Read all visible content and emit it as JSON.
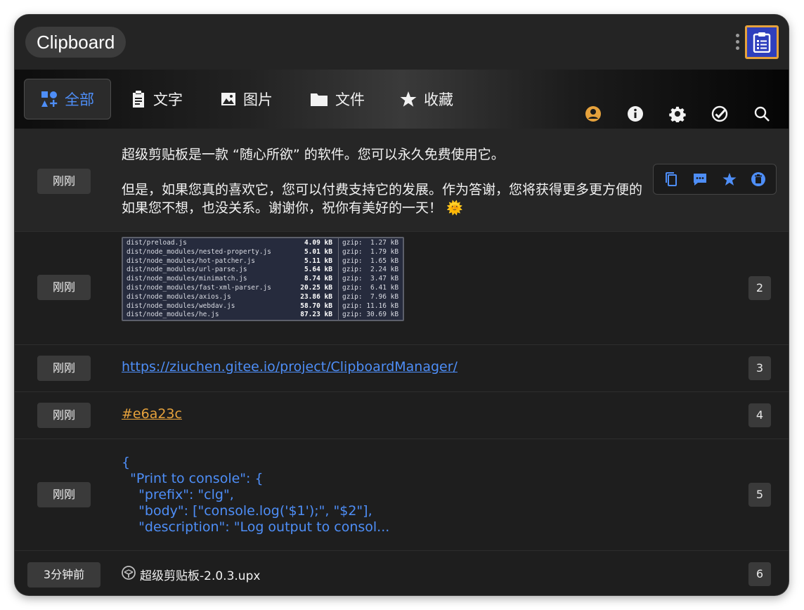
{
  "app": {
    "title": "Clipboard",
    "icon": "clipboard-list-icon"
  },
  "tabs": [
    {
      "label": "全部",
      "icon": "apps-icon",
      "active": true
    },
    {
      "label": "文字",
      "icon": "clipboard-text-icon"
    },
    {
      "label": "图片",
      "icon": "image-icon"
    },
    {
      "label": "文件",
      "icon": "folder-icon"
    },
    {
      "label": "收藏",
      "icon": "star-icon"
    }
  ],
  "tools": [
    "user-circle-icon",
    "info-icon",
    "gear-icon",
    "check-circle-icon",
    "search-icon"
  ],
  "colors": {
    "accent": "#4e8ef7",
    "orange": "#e6a23c",
    "bg": "#1e1e1e",
    "badge": "#3a3a3a"
  },
  "items": [
    {
      "time": "刚刚",
      "type": "text",
      "lines": [
        "超级剪贴板是一款 “随心所欲” 的软件。您可以永久免费使用它。",
        "但是，如果您真的喜欢它，您可以付费支持它的发展。作为答谢，您将获得更多更方便的",
        "如果您不想，也没关系。谢谢你，祝你有美好的一天！ 🌞"
      ],
      "actions": [
        "copy-icon",
        "comment-icon",
        "star-icon",
        "delete-icon"
      ]
    },
    {
      "time": "刚刚",
      "type": "image",
      "index": "2",
      "image_lines": [
        {
          "file": "dist/preload.js",
          "size": "4.09 kB",
          "gzip": "gzip:  1.27 kB"
        },
        {
          "file": "dist/node_modules/nested-property.js",
          "size": "5.01 kB",
          "gzip": "gzip:  1.79 kB"
        },
        {
          "file": "dist/node_modules/hot-patcher.js",
          "size": "5.11 kB",
          "gzip": "gzip:  1.65 kB"
        },
        {
          "file": "dist/node_modules/url-parse.js",
          "size": "5.64 kB",
          "gzip": "gzip:  2.24 kB"
        },
        {
          "file": "dist/node_modules/minimatch.js",
          "size": "8.74 kB",
          "gzip": "gzip:  3.47 kB"
        },
        {
          "file": "dist/node_modules/fast-xml-parser.js",
          "size": "20.25 kB",
          "gzip": "gzip:  6.41 kB"
        },
        {
          "file": "dist/node_modules/axios.js",
          "size": "23.86 kB",
          "gzip": "gzip:  7.96 kB"
        },
        {
          "file": "dist/node_modules/webdav.js",
          "size": "58.70 kB",
          "gzip": "gzip: 11.16 kB"
        },
        {
          "file": "dist/node_modules/he.js",
          "size": "87.23 kB",
          "gzip": "gzip: 30.69 kB"
        }
      ]
    },
    {
      "time": "刚刚",
      "type": "link",
      "index": "3",
      "text": "https://ziuchen.gitee.io/project/ClipboardManager/"
    },
    {
      "time": "刚刚",
      "type": "color",
      "index": "4",
      "text": "#e6a23c"
    },
    {
      "time": "刚刚",
      "type": "code",
      "index": "5",
      "text": "{\n  \"Print to console\": {\n    \"prefix\": \"clg\",\n    \"body\": [\"console.log('$1');\", \"$2\"],\n    \"description\": \"Log output to consol..."
    },
    {
      "time": "3分钟前",
      "type": "file",
      "index": "6",
      "text": "超级剪贴板-2.0.3.upx",
      "icon": "file-icon"
    }
  ]
}
